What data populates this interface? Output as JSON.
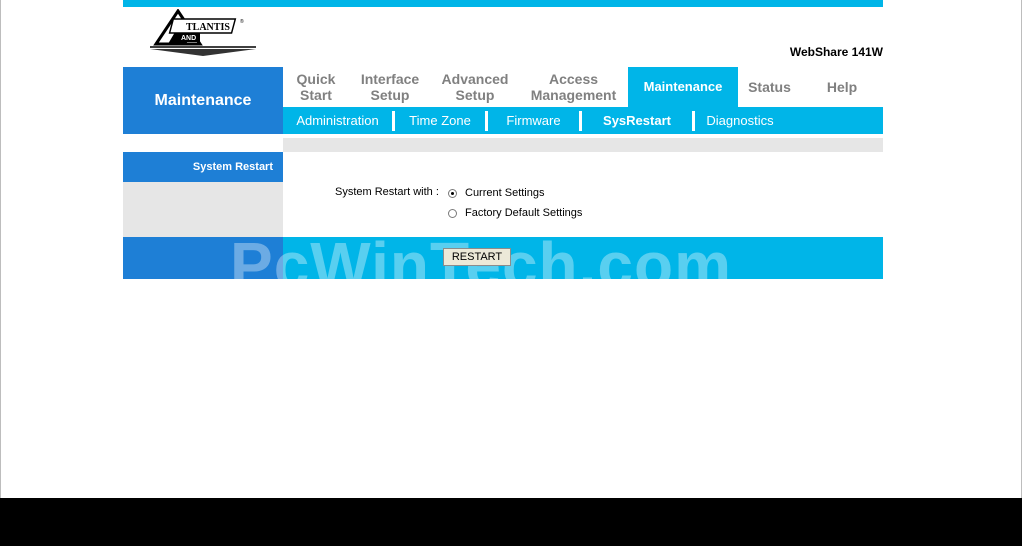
{
  "logo": {
    "text": "ATLANTIS LAND"
  },
  "model": "WebShare 141W",
  "section_header": "Maintenance",
  "top_nav": [
    {
      "label": "Quick\nStart",
      "active": false
    },
    {
      "label": "Interface\nSetup",
      "active": false
    },
    {
      "label": "Advanced\nSetup",
      "active": false
    },
    {
      "label": "Access\nManagement",
      "active": false
    },
    {
      "label": "Maintenance",
      "active": true
    },
    {
      "label": "Status",
      "active": false
    },
    {
      "label": "Help",
      "active": false
    }
  ],
  "sub_nav": [
    {
      "label": "Administration",
      "active": false
    },
    {
      "label": "Time Zone",
      "active": false
    },
    {
      "label": "Firmware",
      "active": false
    },
    {
      "label": "SysRestart",
      "active": true
    },
    {
      "label": "Diagnostics",
      "active": false
    }
  ],
  "panel": {
    "title": "System Restart",
    "label": "System Restart with :",
    "options": [
      {
        "label": "Current Settings",
        "selected": true
      },
      {
        "label": "Factory Default Settings",
        "selected": false
      }
    ],
    "button": "RESTART"
  },
  "watermark": "PcWinTech.com",
  "colors": {
    "accent": "#00b5e8",
    "header_blue": "#1e7fd6",
    "band_gray": "#e6e6e6"
  }
}
